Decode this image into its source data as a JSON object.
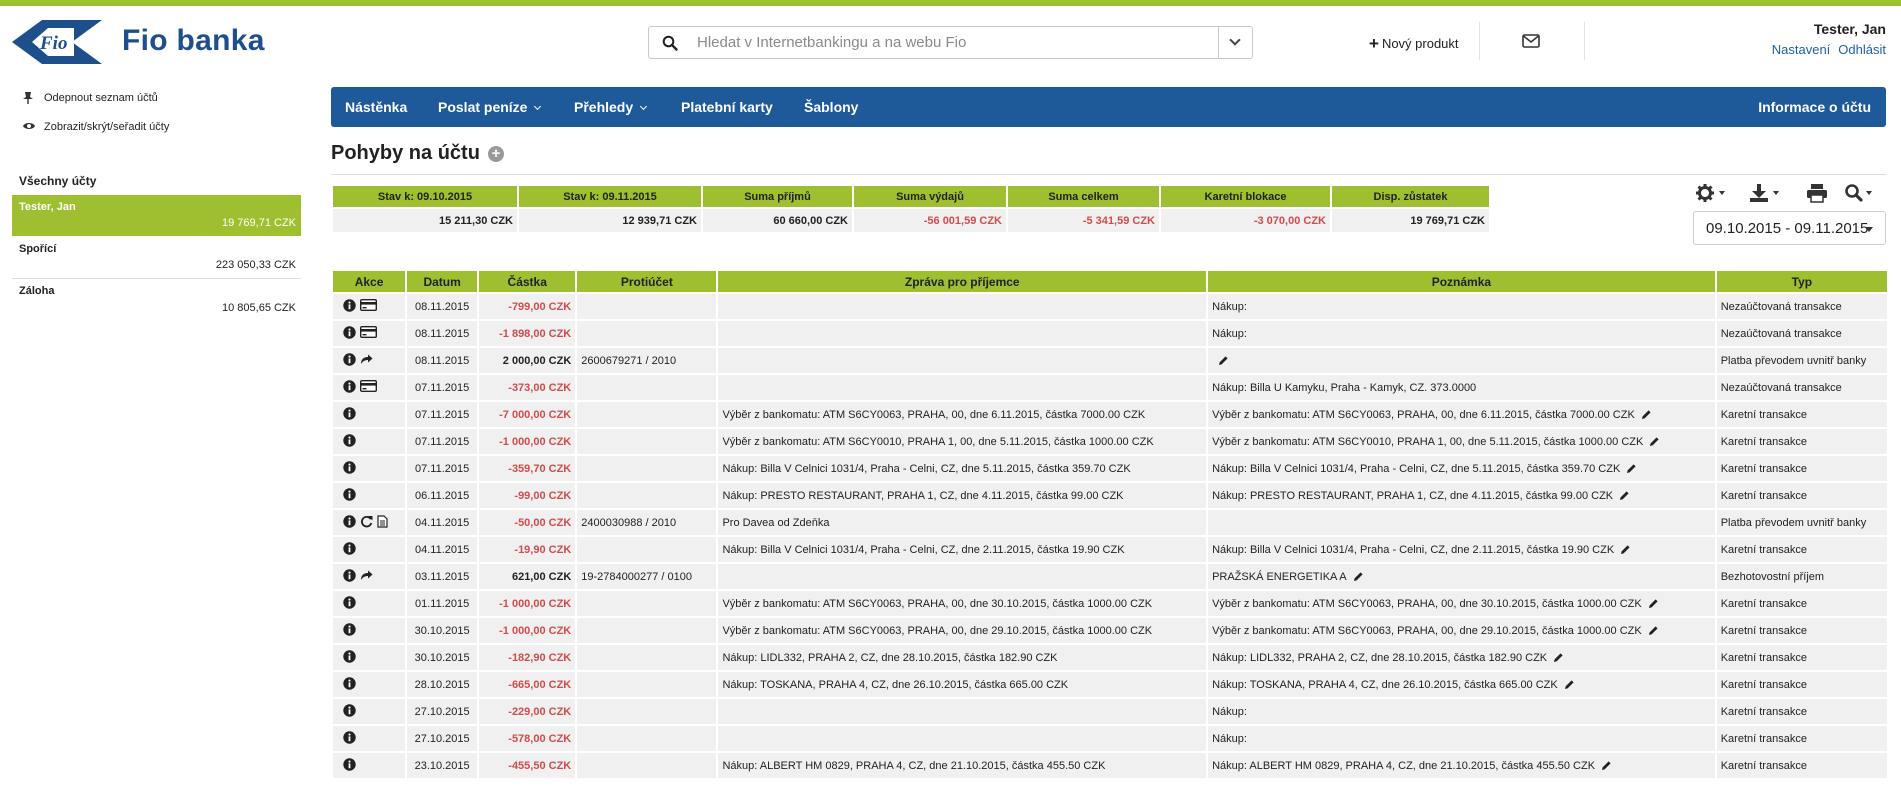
{
  "header": {
    "logo_text": "Fio banka",
    "search_placeholder": "Hledat v Internetbankingu a na webu Fio",
    "new_product": "Nový produkt",
    "user_name": "Tester, Jan",
    "settings_link": "Nastavení",
    "logout_link": "Odhlásit"
  },
  "sidebar": {
    "unpin": "Odepnout seznam účtů",
    "toggle": "Zobrazit/skrýt/seřadit účty",
    "all_accounts": "Všechny účty",
    "accounts": [
      {
        "name": "Tester, Jan",
        "balance": "19 769,71 CZK"
      },
      {
        "name": "Spořící",
        "balance": "223 050,33 CZK"
      },
      {
        "name": "Záloha",
        "balance": "10 805,65 CZK"
      }
    ]
  },
  "nav": {
    "items": [
      "Nástěnka",
      "Poslat peníze",
      "Přehledy",
      "Platební karty",
      "Šablony"
    ],
    "right": "Informace o účtu"
  },
  "page": {
    "title": "Pohyby na účtu"
  },
  "summary": {
    "headers": [
      "Stav k: 09.10.2015",
      "Stav k: 09.11.2015",
      "Suma příjmů",
      "Suma výdajů",
      "Suma celkem",
      "Karetní blokace",
      "Disp. zůstatek"
    ],
    "values": [
      "15 211,30 CZK",
      "12 939,71 CZK",
      "60 660,00 CZK",
      "-56 001,59 CZK",
      "-5 341,59 CZK",
      "-3 070,00 CZK",
      "19 769,71 CZK"
    ]
  },
  "daterange": "09.10.2015 - 09.11.2015",
  "table": {
    "headers": [
      "Akce",
      "Datum",
      "Částka",
      "Protiúčet",
      "Zpráva pro příjemce",
      "Poznámka",
      "Typ"
    ],
    "rows": [
      {
        "icons": [
          "info",
          "card"
        ],
        "date": "08.11.2015",
        "amount": "-799,00 CZK",
        "acct": "",
        "msg": "",
        "note": "Nákup:",
        "pen": false,
        "type": "Nezaúčtovaná transakce"
      },
      {
        "icons": [
          "info",
          "card"
        ],
        "date": "08.11.2015",
        "amount": "-1 898,00 CZK",
        "acct": "",
        "msg": "",
        "note": "Nákup:",
        "pen": false,
        "type": "Nezaúčtovaná transakce"
      },
      {
        "icons": [
          "info",
          "share"
        ],
        "date": "08.11.2015",
        "amount": "2 000,00 CZK",
        "acct": "2600679271 / 2010",
        "msg": "",
        "note": "",
        "pen": true,
        "type": "Platba převodem uvnitř banky"
      },
      {
        "icons": [
          "info",
          "card"
        ],
        "date": "07.11.2015",
        "amount": "-373,00 CZK",
        "acct": "",
        "msg": "",
        "note": "Nákup: Billa U Kamyku, Praha - Kamyk, CZ. 373.0000",
        "pen": false,
        "type": "Nezaúčtovaná transakce"
      },
      {
        "icons": [
          "info"
        ],
        "date": "07.11.2015",
        "amount": "-7 000,00 CZK",
        "acct": "",
        "msg": "Výběr z bankomatu: ATM S6CY0063, PRAHA, 00, dne 6.11.2015, částka 7000.00 CZK",
        "note": "Výběr z bankomatu: ATM S6CY0063, PRAHA, 00, dne 6.11.2015, částka 7000.00 CZK",
        "pen": true,
        "type": "Karetní transakce"
      },
      {
        "icons": [
          "info"
        ],
        "date": "07.11.2015",
        "amount": "-1 000,00 CZK",
        "acct": "",
        "msg": "Výběr z bankomatu: ATM S6CY0010, PRAHA 1, 00, dne 5.11.2015, částka 1000.00 CZK",
        "note": "Výběr z bankomatu: ATM S6CY0010, PRAHA 1, 00, dne 5.11.2015, částka 1000.00 CZK",
        "pen": true,
        "type": "Karetní transakce"
      },
      {
        "icons": [
          "info"
        ],
        "date": "07.11.2015",
        "amount": "-359,70 CZK",
        "acct": "",
        "msg": "Nákup: Billa V Celnici 1031/4, Praha - Celni, CZ, dne 5.11.2015, částka 359.70 CZK",
        "note": "Nákup: Billa V Celnici 1031/4, Praha - Celni, CZ, dne 5.11.2015, částka 359.70 CZK",
        "pen": true,
        "type": "Karetní transakce"
      },
      {
        "icons": [
          "info"
        ],
        "date": "06.11.2015",
        "amount": "-99,00 CZK",
        "acct": "",
        "msg": "Nákup: PRESTO RESTAURANT, PRAHA 1, CZ, dne 4.11.2015, částka 99.00 CZK",
        "note": "Nákup: PRESTO RESTAURANT, PRAHA 1, CZ, dne 4.11.2015, částka 99.00 CZK",
        "pen": true,
        "type": "Karetní transakce"
      },
      {
        "icons": [
          "info",
          "repeat",
          "doc"
        ],
        "date": "04.11.2015",
        "amount": "-50,00 CZK",
        "acct": "2400030988 / 2010",
        "msg": "Pro Davea od Zdeňka",
        "note": "",
        "pen": false,
        "type": "Platba převodem uvnitř banky"
      },
      {
        "icons": [
          "info"
        ],
        "date": "04.11.2015",
        "amount": "-19,90 CZK",
        "acct": "",
        "msg": "Nákup: Billa V Celnici 1031/4, Praha - Celni, CZ, dne 2.11.2015, částka 19.90 CZK",
        "note": "Nákup: Billa V Celnici 1031/4, Praha - Celni, CZ, dne 2.11.2015, částka 19.90 CZK",
        "pen": true,
        "type": "Karetní transakce"
      },
      {
        "icons": [
          "info",
          "share"
        ],
        "date": "03.11.2015",
        "amount": "621,00 CZK",
        "acct": "19-2784000277 / 0100",
        "msg": "",
        "note": "PRAŽSKÁ ENERGETIKA A",
        "pen": true,
        "type": "Bezhotovostní příjem"
      },
      {
        "icons": [
          "info"
        ],
        "date": "01.11.2015",
        "amount": "-1 000,00 CZK",
        "acct": "",
        "msg": "Výběr z bankomatu: ATM S6CY0063, PRAHA, 00, dne 30.10.2015, částka 1000.00 CZK",
        "note": "Výběr z bankomatu: ATM S6CY0063, PRAHA, 00, dne 30.10.2015, částka 1000.00 CZK",
        "pen": true,
        "type": "Karetní transakce"
      },
      {
        "icons": [
          "info"
        ],
        "date": "30.10.2015",
        "amount": "-1 000,00 CZK",
        "acct": "",
        "msg": "Výběr z bankomatu: ATM S6CY0063, PRAHA, 00, dne 29.10.2015, částka 1000.00 CZK",
        "note": "Výběr z bankomatu: ATM S6CY0063, PRAHA, 00, dne 29.10.2015, částka 1000.00 CZK",
        "pen": true,
        "type": "Karetní transakce"
      },
      {
        "icons": [
          "info"
        ],
        "date": "30.10.2015",
        "amount": "-182,90 CZK",
        "acct": "",
        "msg": "Nákup: LIDL332, PRAHA 2, CZ, dne 28.10.2015, částka 182.90 CZK",
        "note": "Nákup: LIDL332, PRAHA 2, CZ, dne 28.10.2015, částka 182.90 CZK",
        "pen": true,
        "type": "Karetní transakce"
      },
      {
        "icons": [
          "info"
        ],
        "date": "28.10.2015",
        "amount": "-665,00 CZK",
        "acct": "",
        "msg": "Nákup: TOSKANA, PRAHA 4, CZ, dne 26.10.2015, částka 665.00 CZK",
        "note": "Nákup: TOSKANA, PRAHA 4, CZ, dne 26.10.2015, částka 665.00 CZK",
        "pen": true,
        "type": "Karetní transakce"
      },
      {
        "icons": [
          "info"
        ],
        "date": "27.10.2015",
        "amount": "-229,00 CZK",
        "acct": "",
        "msg": "",
        "note": "Nákup:",
        "pen": false,
        "type": "Karetní transakce"
      },
      {
        "icons": [
          "info"
        ],
        "date": "27.10.2015",
        "amount": "-578,00 CZK",
        "acct": "",
        "msg": "",
        "note": "Nákup:",
        "pen": false,
        "type": "Karetní transakce"
      },
      {
        "icons": [
          "info"
        ],
        "date": "23.10.2015",
        "amount": "-455,50 CZK",
        "acct": "",
        "msg": "Nákup: ALBERT HM 0829, PRAHA 4, CZ, dne 21.10.2015, částka 455.50 CZK",
        "note": "Nákup: ALBERT HM 0829, PRAHA 4, CZ, dne 21.10.2015, částka 455.50 CZK",
        "pen": true,
        "type": "Karetní transakce"
      }
    ]
  }
}
